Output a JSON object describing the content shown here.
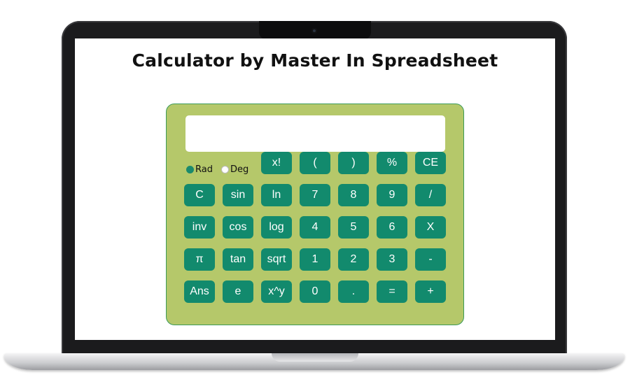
{
  "page": {
    "title": "Calculator by Master In Spreadsheet"
  },
  "calculator": {
    "display_value": "",
    "angle_mode": {
      "options": [
        {
          "label": "Rad",
          "checked": true
        },
        {
          "label": "Deg",
          "checked": false
        }
      ]
    },
    "keys": [
      [
        "x!",
        "(",
        ")",
        "%",
        "CE"
      ],
      [
        "C",
        "sin",
        "ln",
        "7",
        "8",
        "9",
        "/"
      ],
      [
        "inv",
        "cos",
        "log",
        "4",
        "5",
        "6",
        "X"
      ],
      [
        "π",
        "tan",
        "sqrt",
        "1",
        "2",
        "3",
        "-"
      ],
      [
        "Ans",
        "e",
        "x^y",
        "0",
        ".",
        "=",
        "+"
      ]
    ]
  },
  "colors": {
    "panel": "#b5c86a",
    "panel_border": "#3b9a58",
    "key": "#128a6d",
    "key_text": "#ffffff"
  }
}
